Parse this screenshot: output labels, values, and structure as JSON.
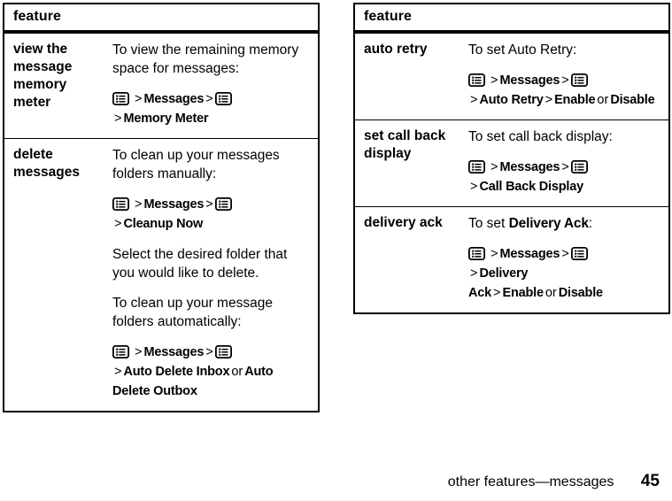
{
  "footer": {
    "section_title": "other features—messages",
    "page_number": "45"
  },
  "icons": {
    "menu_key": "menu-key-icon"
  },
  "tables": [
    {
      "id": "left",
      "header": "feature",
      "rows": [
        {
          "name": "view the message memory meter",
          "blocks": [
            {
              "type": "para",
              "text": "To view the remaining memory space for messages:"
            },
            {
              "type": "menu-path",
              "segments": [
                {
                  "kind": "icon",
                  "text": "menu-key-icon"
                },
                {
                  "kind": "sep",
                  "text": ">"
                },
                {
                  "kind": "item",
                  "text": "Messages"
                },
                {
                  "kind": "sep",
                  "text": ">"
                },
                {
                  "kind": "icon",
                  "text": "menu-key-icon"
                },
                {
                  "kind": "break",
                  "text": ""
                },
                {
                  "kind": "sep",
                  "text": ">"
                },
                {
                  "kind": "item",
                  "text": "Memory Meter"
                }
              ]
            }
          ]
        },
        {
          "name": "delete messages",
          "blocks": [
            {
              "type": "para",
              "text": "To clean up your messages folders manually:"
            },
            {
              "type": "menu-path",
              "segments": [
                {
                  "kind": "icon",
                  "text": "menu-key-icon"
                },
                {
                  "kind": "sep",
                  "text": ">"
                },
                {
                  "kind": "item",
                  "text": "Messages"
                },
                {
                  "kind": "sep",
                  "text": ">"
                },
                {
                  "kind": "icon",
                  "text": "menu-key-icon"
                },
                {
                  "kind": "break",
                  "text": ""
                },
                {
                  "kind": "sep",
                  "text": ">"
                },
                {
                  "kind": "item",
                  "text": "Cleanup Now"
                }
              ]
            },
            {
              "type": "para",
              "text": "Select the desired folder that you would like to delete."
            },
            {
              "type": "para",
              "text": "To clean up your message folders automatically:"
            },
            {
              "type": "menu-path",
              "segments": [
                {
                  "kind": "icon",
                  "text": "menu-key-icon"
                },
                {
                  "kind": "sep",
                  "text": ">"
                },
                {
                  "kind": "item",
                  "text": "Messages"
                },
                {
                  "kind": "sep",
                  "text": ">"
                },
                {
                  "kind": "icon",
                  "text": "menu-key-icon"
                },
                {
                  "kind": "break",
                  "text": ""
                },
                {
                  "kind": "sep",
                  "text": ">"
                },
                {
                  "kind": "item",
                  "text": "Auto Delete Inbox"
                },
                {
                  "kind": "or",
                  "text": "or"
                },
                {
                  "kind": "item",
                  "text": "Auto Delete Outbox"
                }
              ]
            }
          ]
        }
      ]
    },
    {
      "id": "right",
      "header": "feature",
      "rows": [
        {
          "name": "auto retry",
          "blocks": [
            {
              "type": "para",
              "text": "To set Auto Retry:"
            },
            {
              "type": "menu-path",
              "segments": [
                {
                  "kind": "icon",
                  "text": "menu-key-icon"
                },
                {
                  "kind": "sep",
                  "text": ">"
                },
                {
                  "kind": "item",
                  "text": "Messages"
                },
                {
                  "kind": "sep",
                  "text": ">"
                },
                {
                  "kind": "icon",
                  "text": "menu-key-icon"
                },
                {
                  "kind": "break",
                  "text": ""
                },
                {
                  "kind": "sep",
                  "text": ">"
                },
                {
                  "kind": "item",
                  "text": "Auto Retry"
                },
                {
                  "kind": "sep",
                  "text": ">"
                },
                {
                  "kind": "item",
                  "text": "Enable"
                },
                {
                  "kind": "or",
                  "text": "or"
                },
                {
                  "kind": "item",
                  "text": "Disable"
                }
              ]
            }
          ]
        },
        {
          "name": "set call back display",
          "blocks": [
            {
              "type": "para",
              "text": "To set call back display:"
            },
            {
              "type": "menu-path",
              "segments": [
                {
                  "kind": "icon",
                  "text": "menu-key-icon"
                },
                {
                  "kind": "sep",
                  "text": ">"
                },
                {
                  "kind": "item",
                  "text": "Messages"
                },
                {
                  "kind": "sep",
                  "text": ">"
                },
                {
                  "kind": "icon",
                  "text": "menu-key-icon"
                },
                {
                  "kind": "break",
                  "text": ""
                },
                {
                  "kind": "sep",
                  "text": ">"
                },
                {
                  "kind": "item",
                  "text": "Call Back Display"
                }
              ]
            }
          ]
        },
        {
          "name": "delivery ack",
          "blocks": [
            {
              "type": "para-mixed",
              "segments": [
                {
                  "kind": "plain",
                  "text": "To set "
                },
                {
                  "kind": "setting",
                  "text": "Delivery Ack"
                },
                {
                  "kind": "plain",
                  "text": ":"
                }
              ]
            },
            {
              "type": "menu-path",
              "segments": [
                {
                  "kind": "icon",
                  "text": "menu-key-icon"
                },
                {
                  "kind": "sep",
                  "text": ">"
                },
                {
                  "kind": "item",
                  "text": "Messages"
                },
                {
                  "kind": "sep",
                  "text": ">"
                },
                {
                  "kind": "icon",
                  "text": "menu-key-icon"
                },
                {
                  "kind": "break",
                  "text": ""
                },
                {
                  "kind": "sep",
                  "text": ">"
                },
                {
                  "kind": "item",
                  "text": "Delivery Ack"
                },
                {
                  "kind": "sep",
                  "text": ">"
                },
                {
                  "kind": "item",
                  "text": "Enable"
                },
                {
                  "kind": "or",
                  "text": "or"
                },
                {
                  "kind": "item",
                  "text": "Disable"
                }
              ]
            }
          ]
        }
      ]
    }
  ]
}
